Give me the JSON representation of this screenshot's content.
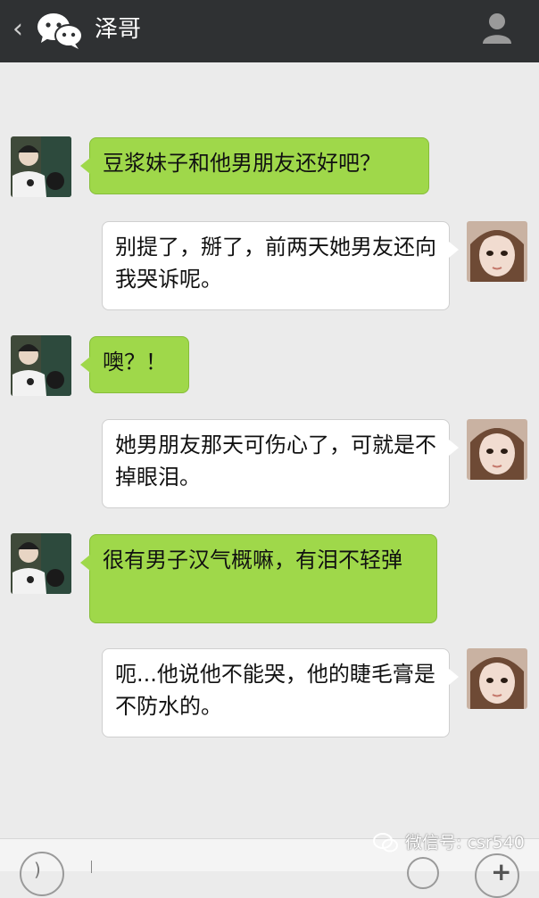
{
  "header": {
    "back_glyph": "‹",
    "title": "泽哥"
  },
  "messages": [
    {
      "side": "left",
      "color": "green",
      "text": "豆浆妹子和他男朋友还好吧？"
    },
    {
      "side": "right",
      "color": "white",
      "text": "别提了，掰了，前两天她男友还向我哭诉呢。"
    },
    {
      "side": "left",
      "color": "green",
      "text": "噢？！"
    },
    {
      "side": "right",
      "color": "white",
      "text": "她男朋友那天可伤心了，可就是不掉眼泪。"
    },
    {
      "side": "left",
      "color": "green",
      "text": "很有男子汉气概嘛，有泪不轻弹"
    },
    {
      "side": "right",
      "color": "white",
      "text": "呃...他说他不能哭，他的睫毛膏是不防水的。"
    }
  ],
  "input_bar": {
    "voice_icon": "voice-icon",
    "emoji_icon": "emoji-icon",
    "plus_glyph": "+"
  },
  "watermark": {
    "text": "微信号: csr540"
  },
  "colors": {
    "header_bg": "#2f3133",
    "chat_bg": "#ebebeb",
    "sent_bubble": "#9fd84a",
    "received_bubble": "#ffffff"
  }
}
